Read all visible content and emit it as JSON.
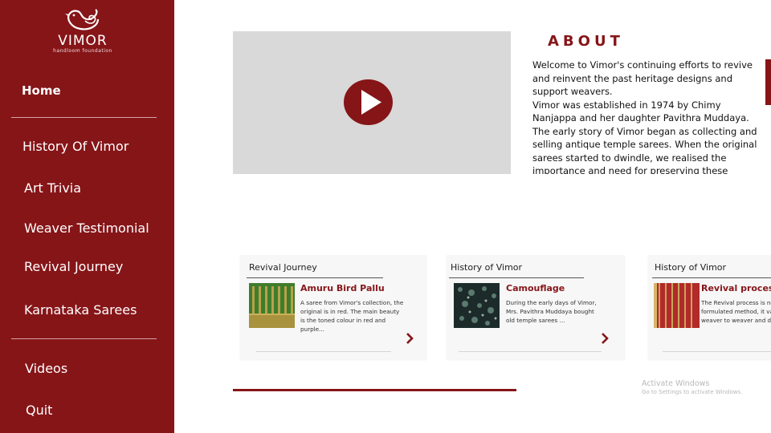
{
  "brand": {
    "name": "VIMOR",
    "tagline": "handloom foundation"
  },
  "sidebar": {
    "home_label": "Home",
    "items": [
      {
        "label": "History Of Vimor"
      },
      {
        "label": "Art Trivia"
      },
      {
        "label": "Weaver Testimonial"
      },
      {
        "label": "Revival Journey"
      },
      {
        "label": "Karnataka Sarees"
      }
    ],
    "bottom_items": [
      {
        "label": "Videos"
      },
      {
        "label": "Quit"
      }
    ]
  },
  "about": {
    "title": "ABOUT",
    "paragraphs": [
      "Welcome to Vimor's continuing efforts to revive and reinvent the past heritage designs and support weavers.",
      "Vimor was established in 1974 by Chimy Nanjappa and her daughter Pavithra Muddaya.",
      "The early story of Vimor began as collecting and selling antique temple sarees. When the original sarees started to dwindle, we realised the importance and need for preserving these designs"
    ]
  },
  "video": {
    "play_icon": "play-icon"
  },
  "cards": [
    {
      "category": "Revival Journey",
      "title": "Amuru Bird Pallu",
      "description": "A saree from Vimor's collection, the original is in red. The main beauty is the toned colour in red and purple...",
      "thumb_colors": [
        "#3f7d2c",
        "#b7a24a"
      ]
    },
    {
      "category": "History of Vimor",
      "title": "Camouflage",
      "description": "During the early days of Vimor, Mrs. Pavithra Muddaya bought old temple sarees ...",
      "thumb_colors": [
        "#1c2a2a",
        "#5a7a6e"
      ]
    },
    {
      "category": "History of Vimor",
      "title": "Revival process",
      "description": "The Revival process is no formulated method, it va weaver to weaver and d",
      "thumb_colors": [
        "#b22a2a",
        "#c9a55a"
      ]
    }
  ],
  "watermark": {
    "title": "Activate Windows",
    "subtitle": "Go to Settings to activate Windows."
  },
  "colors": {
    "brand": "#861518",
    "video_placeholder": "#d9d9d9",
    "card_bg": "#f7f7f7"
  }
}
